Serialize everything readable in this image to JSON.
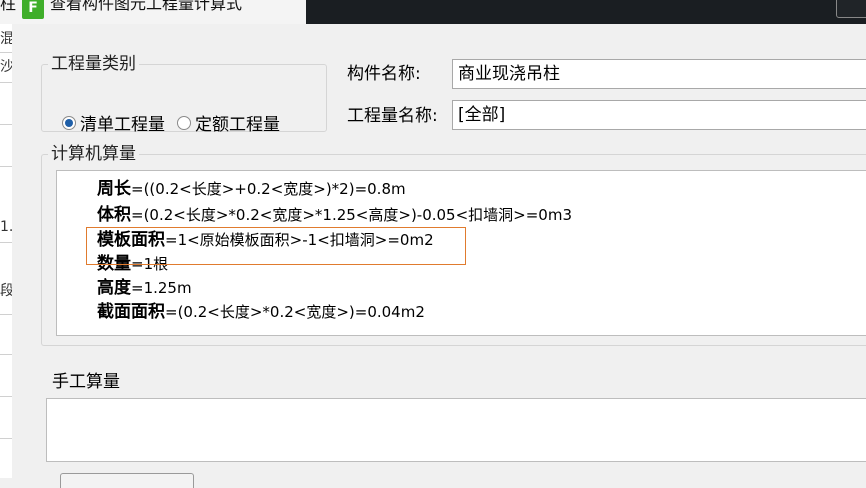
{
  "window": {
    "title": "查看构件图元工程量计算式",
    "icon_glyph": "F",
    "ghost_left_char": "柱"
  },
  "background": {
    "left_chars": [
      "混",
      "沙",
      "1.",
      "段"
    ]
  },
  "quantity_type": {
    "legend": "工程量类别",
    "options": [
      {
        "label": "清单工程量",
        "checked": true
      },
      {
        "label": "定额工程量",
        "checked": false
      }
    ]
  },
  "component_name": {
    "label": "构件名称:",
    "value": "商业现浇吊柱"
  },
  "quantity_name": {
    "label": "工程量名称:",
    "value": "[全部]"
  },
  "computer_calc": {
    "legend": "计算机算量",
    "lines": [
      {
        "name": "周长",
        "formula": "=((0.2<长度>+0.2<宽度>)*2)=0.8m"
      },
      {
        "name": "体积",
        "formula": "=(0.2<长度>*0.2<宽度>*1.25<高度>)-0.05<扣墙洞>=0m3"
      },
      {
        "name": "模板面积",
        "formula": "=1<原始模板面积>-1<扣墙洞>=0m2"
      },
      {
        "name": "数量",
        "formula": "=1根"
      },
      {
        "name": "高度",
        "formula": "=1.25m"
      },
      {
        "name": "截面面积",
        "formula": "=(0.2<长度>*0.2<宽度>)=0.04m2"
      }
    ]
  },
  "manual_calc": {
    "legend": "手工算量",
    "value": ""
  },
  "colors": {
    "highlight": "#e07b2e",
    "radio_selected": "#1f5fa8",
    "app_icon": "#3fae2a"
  }
}
